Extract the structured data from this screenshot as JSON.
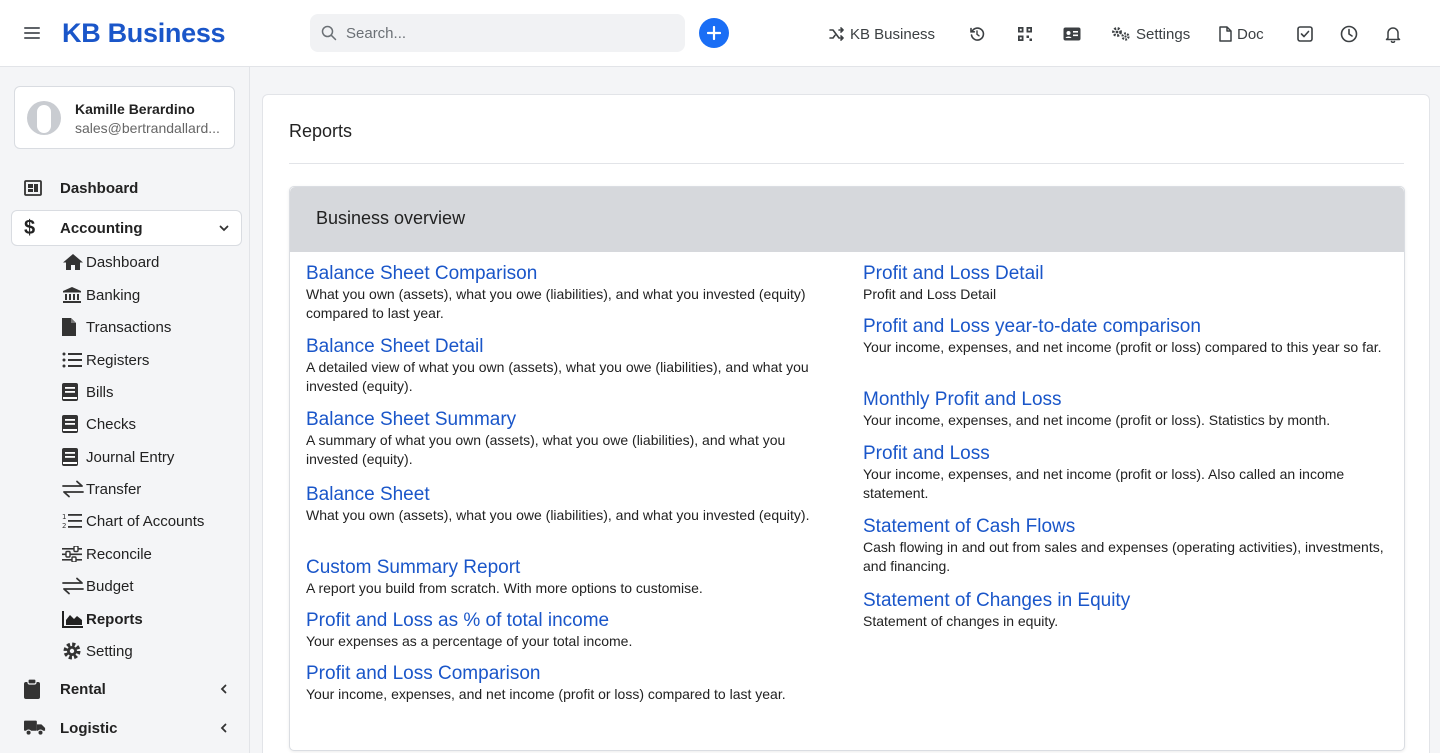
{
  "header": {
    "brand": "KB Business",
    "search_placeholder": "Search...",
    "company_label": "KB Business",
    "settings_label": "Settings",
    "doc_label": "Doc"
  },
  "user": {
    "name": "Kamille Berardino",
    "email": "sales@bertrandallard..."
  },
  "sidebar": {
    "top_items": [
      {
        "label": "Dashboard",
        "icon": "dashboard-icon"
      },
      {
        "label": "Accounting",
        "icon": "dollar-icon"
      },
      {
        "label": "Rental",
        "icon": "clipboard-icon"
      },
      {
        "label": "Logistic",
        "icon": "truck-icon"
      }
    ],
    "sub_items": [
      {
        "label": "Dashboard",
        "icon": "home-icon"
      },
      {
        "label": "Banking",
        "icon": "bank-icon"
      },
      {
        "label": "Transactions",
        "icon": "file-icon"
      },
      {
        "label": "Registers",
        "icon": "list-icon"
      },
      {
        "label": "Bills",
        "icon": "book-icon"
      },
      {
        "label": "Checks",
        "icon": "book-icon"
      },
      {
        "label": "Journal Entry",
        "icon": "book-icon"
      },
      {
        "label": "Transfer",
        "icon": "transfer-icon"
      },
      {
        "label": "Chart of Accounts",
        "icon": "ordered-list-icon"
      },
      {
        "label": "Reconcile",
        "icon": "sliders-icon"
      },
      {
        "label": "Budget",
        "icon": "transfer-icon"
      },
      {
        "label": "Reports",
        "icon": "area-chart-icon"
      },
      {
        "label": "Setting",
        "icon": "gear-icon"
      }
    ]
  },
  "page": {
    "title": "Reports",
    "section_title": "Business overview"
  },
  "reports_left": [
    {
      "title": "Balance Sheet Comparison",
      "desc": "What you own (assets), what you owe (liabilities), and what you invested (equity) compared to last year."
    },
    {
      "title": "Balance Sheet Detail",
      "desc": "A detailed view of what you own (assets), what you owe (liabilities), and what you invested (equity)."
    },
    {
      "title": "Balance Sheet Summary",
      "desc": "A summary of what you own (assets), what you owe (liabilities), and what you invested (equity)."
    },
    {
      "title": "Balance Sheet",
      "desc": "What you own (assets), what you owe (liabilities), and what you invested (equity)."
    },
    {
      "title": "Custom Summary Report",
      "desc": "A report you build from scratch. With more options to customise."
    },
    {
      "title": "Profit and Loss as % of total income",
      "desc": "Your expenses as a percentage of your total income."
    },
    {
      "title": "Profit and Loss Comparison",
      "desc": "Your income, expenses, and net income (profit or loss) compared to last year."
    }
  ],
  "reports_right": [
    {
      "title": "Profit and Loss Detail",
      "desc": "Profit and Loss Detail"
    },
    {
      "title": "Profit and Loss year-to-date comparison",
      "desc": "Your income, expenses, and net income (profit or loss) compared to this year so far."
    },
    {
      "title": "Monthly Profit and Loss",
      "desc": "Your income, expenses, and net income (profit or loss). Statistics by month."
    },
    {
      "title": "Profit and Loss",
      "desc": "Your income, expenses, and net income (profit or loss). Also called an income statement."
    },
    {
      "title": "Statement of Cash Flows",
      "desc": "Cash flowing in and out from sales and expenses (operating activities), investments, and financing."
    },
    {
      "title": "Statement of Changes in Equity",
      "desc": "Statement of changes in equity."
    }
  ],
  "colors": {
    "brand": "#1a56c9",
    "accent": "#1a6ef5",
    "section_header": "#d6d8dc"
  }
}
